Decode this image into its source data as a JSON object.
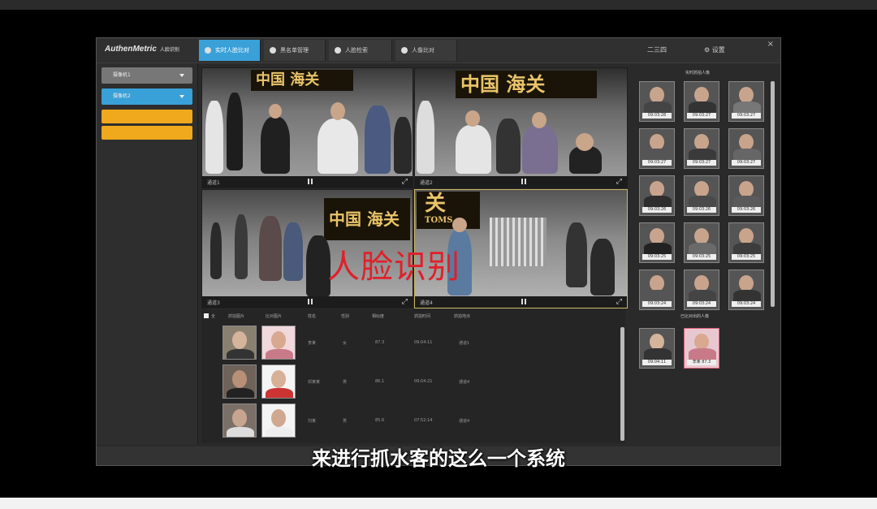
{
  "app": {
    "logo": "AuthenMetric",
    "logo_sub": "人脸识别",
    "tabs": [
      {
        "label": "实时人脸比对",
        "active": true
      },
      {
        "label": "黑名单管理",
        "active": false
      },
      {
        "label": "人脸检索",
        "active": false
      },
      {
        "label": "人像比对",
        "active": false
      }
    ],
    "header_right": {
      "display": "二三四",
      "settings_label": "设置"
    }
  },
  "sidebar": {
    "items": [
      {
        "label": "摄像机1",
        "style": "gray"
      },
      {
        "label": "摄像机2",
        "style": "blue"
      },
      {
        "label": "",
        "style": "yellow"
      },
      {
        "label": "",
        "style": "yellow"
      }
    ]
  },
  "videos": [
    {
      "sign": "中国   海关",
      "label": "通道1"
    },
    {
      "sign": "中国   海关",
      "label": "通道2"
    },
    {
      "sign": "中国 海关",
      "label": "通道3"
    },
    {
      "sign": "关",
      "sign2": "TOMS",
      "label": "通道4"
    }
  ],
  "overlay_text": "人脸识别",
  "subtitle": "来进行抓水客的这么一个系统",
  "list": {
    "select_all": "全",
    "headers": [
      "抓拍图片",
      "比对图片",
      "姓名",
      "性别",
      "相似度",
      "抓拍时间",
      "抓拍地点"
    ],
    "rows": [
      {
        "name": "李某",
        "gender": "女",
        "score": "87.3",
        "time": "09:04:11",
        "place": "通道1"
      },
      {
        "name": "邓某某",
        "gender": "男",
        "score": "86.1",
        "time": "09:04:21",
        "place": "通道4"
      },
      {
        "name": "刘某",
        "gender": "男",
        "score": "85.6",
        "time": "07:52:14",
        "place": "通道4"
      }
    ]
  },
  "right_panel": {
    "title_top": "实时抓拍人像",
    "title_bottom": "已比对出的人像",
    "thumbs": [
      "09:03:28",
      "09:03:27",
      "09:03:27",
      "09:03:27",
      "09:03:27",
      "09:03:27",
      "09:03:26",
      "09:03:26",
      "09:03:26",
      "09:03:25",
      "09:03:25",
      "09:03:25",
      "09:03:24",
      "09:03:24",
      "09:03:24"
    ],
    "matched": [
      "09:04:11",
      "李某 87.3"
    ]
  },
  "colors": {
    "accent": "#3aa0d8",
    "warning": "#f0a91c",
    "overlay": "#e0202a"
  }
}
